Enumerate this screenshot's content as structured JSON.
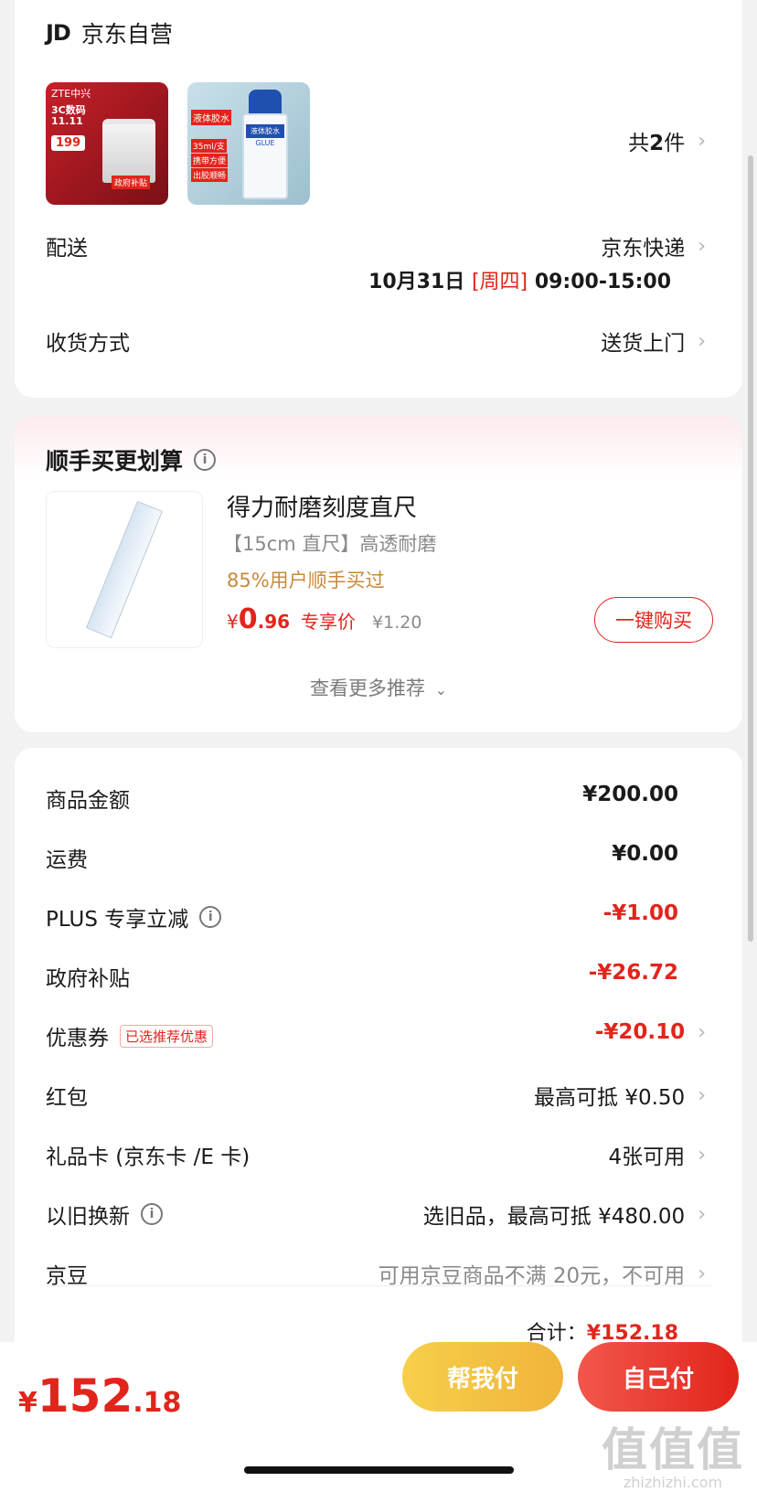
{
  "shop": {
    "logo": "JD",
    "name": "京东自营"
  },
  "products": {
    "count_prefix": "共",
    "count": "2",
    "count_suffix": "件",
    "router": {
      "brand": "ZTE中兴",
      "line1": "3C数码",
      "line2": "11.11",
      "price": "199",
      "tag": "政府补贴"
    },
    "glue": {
      "label1": "液体胶水",
      "label2": "35ml/支",
      "label3": "携带方便",
      "label4": "出胶顺畅",
      "bottle": "液体胶水",
      "bottle_sub": "GLUE"
    }
  },
  "delivery": {
    "label": "配送",
    "method": "京东快递",
    "date": "10月31日",
    "weekday": "[周四]",
    "time": "09:00-15:00"
  },
  "receive": {
    "label": "收货方式",
    "value": "送货上门"
  },
  "addon": {
    "title": "顺手买更划算",
    "product_name": "得力耐磨刻度直尺",
    "desc": "【15cm 直尺】高透耐磨",
    "social": "85%用户顺手买过",
    "price_symbol": "¥",
    "price_int": "0",
    "price_dec": ".96",
    "price_tag": "专享价",
    "orig_price": "¥1.20",
    "buy_button": "一键购买",
    "more": "查看更多推荐"
  },
  "summary": {
    "rows": [
      {
        "label": "商品金额",
        "value": "¥200.00"
      },
      {
        "label": "运费",
        "value": "¥0.00"
      },
      {
        "label": "PLUS 专享立减",
        "value": "-¥1.00"
      },
      {
        "label": "政府补贴",
        "value": "-¥26.72"
      },
      {
        "label": "优惠券",
        "badge": "已选推荐优惠",
        "value": "-¥20.10"
      },
      {
        "label": "红包",
        "value": "最高可抵 ¥0.50"
      },
      {
        "label": "礼品卡 (京东卡 /E 卡)",
        "value": "4张可用"
      },
      {
        "label": "以旧换新",
        "value": "选旧品，最高可抵 ¥480.00"
      },
      {
        "label": "京豆",
        "value": "可用京豆商品不满 20元，不可用"
      }
    ],
    "total_label": "合计：",
    "total_value": "¥152.18"
  },
  "bottom": {
    "symbol": "¥",
    "int": "152",
    "dec": ".18",
    "help_pay": "帮我付",
    "self_pay": "自己付"
  },
  "watermark": {
    "text": "值值值",
    "sub": "zhizhizhi.com"
  },
  "colors": {
    "accent": "#e1251b",
    "gold": "#f2c94c"
  }
}
